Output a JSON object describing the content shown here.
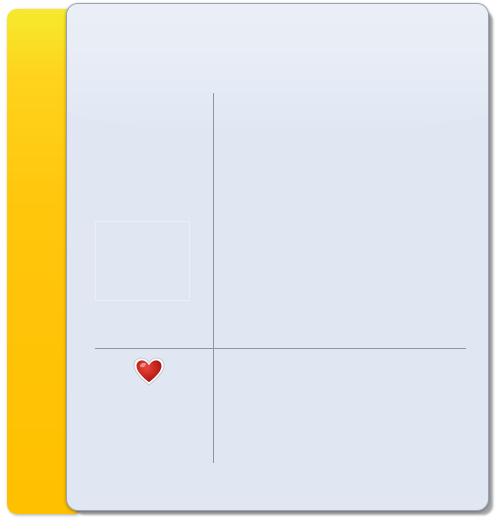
{
  "panel": {
    "accent_color": "#ffc000",
    "panel_color": "#e0e7f3",
    "grid_line_color": "#8f96a3"
  },
  "grid": {
    "cells": [
      "top-left",
      "top-right",
      "bottom-left",
      "bottom-right"
    ]
  },
  "icons": {
    "marker": "heart-icon",
    "marker_color": "#c4231c"
  }
}
